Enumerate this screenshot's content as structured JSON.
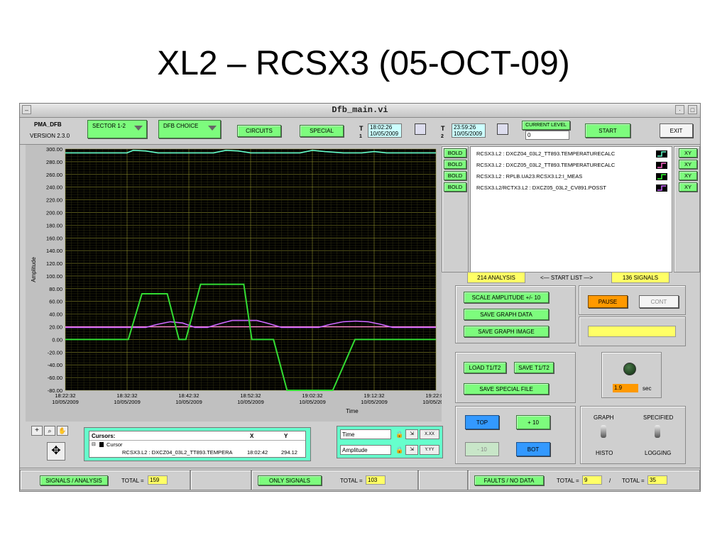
{
  "slide": {
    "title": "XL2 – RCSX3 (05-OCT-09)"
  },
  "window": {
    "title": "Dfb_main.vi",
    "min_glyph": "–",
    "max_glyph": "□"
  },
  "header": {
    "app_name": "PMA_DFB",
    "version": "VERSION 2.3.0",
    "sector_dropdown": "SECTOR 1-2",
    "dfb_dropdown": "DFB CHOICE",
    "circuits_button": "CIRCUITS",
    "special_button": "SPECIAL",
    "t1_label": "T",
    "t1_index": "1",
    "t1_time": "18:02:26",
    "t1_date": "10/05/2009",
    "t2_label": "T",
    "t2_index": "2",
    "t2_time": "23:59:26",
    "t2_date": "10/05/2009",
    "current_level_label": "CURRENT LEVEL",
    "current_level_value": "0",
    "start_button": "START",
    "exit_button": "EXIT"
  },
  "signals": [
    {
      "bold": "BOLD",
      "name": "RCSX3.L2 : DXCZ04_03L2_TT893.TEMPERATURECALC",
      "color": "#66ffcc",
      "xy": "XY"
    },
    {
      "bold": "BOLD",
      "name": "RCSX3.L2 : DXCZ05_03L2_TT893.TEMPERATURECALC",
      "color": "#ff66cc",
      "xy": "XY"
    },
    {
      "bold": "BOLD",
      "name": "RCSX3.L2 : RPLB.UA23.RCSX3.L2:I_MEAS",
      "color": "#33ff33",
      "xy": "XY"
    },
    {
      "bold": "BOLD",
      "name": "RCSX3.L2/RCTX3.L2 : DXCZ05_03L2_CV891.POSST",
      "color": "#cc66ff",
      "xy": "XY"
    }
  ],
  "start_list": {
    "analysis": "214 ANALYSIS",
    "label": "<— START LIST —>",
    "signals": "136 SIGNALS"
  },
  "controls": {
    "scale_amplitude": "SCALE AMPLITUDE +/- 10",
    "save_graph_data": "SAVE GRAPH DATA",
    "save_graph_image": "SAVE GRAPH IMAGE",
    "pause": "PAUSE",
    "cont": "CONT",
    "load_t1t2": "LOAD T1/T2",
    "save_t1t2": "SAVE T1/T2",
    "save_special_file": "SAVE SPECIAL FILE",
    "refresh_value": "1.9",
    "refresh_unit": "sec",
    "top": "TOP",
    "plus10": "+ 10",
    "minus10": "- 10",
    "bot": "BOT",
    "graph_label": "GRAPH",
    "histo_label": "HISTO",
    "specified_label": "SPECIFIED",
    "logging_label": "LOGGING"
  },
  "cursor_panel": {
    "header_cursors": "Cursors:",
    "header_x": "X",
    "header_y": "Y",
    "tree_root": "Cursor",
    "tree_item": "RCSX3.L2 : DXCZ04_03L2_TT893.TEMPERA",
    "x_value": "18:02:42",
    "y_value": "294.12"
  },
  "axis_controls": {
    "time": "Time",
    "amplitude": "Amplitude",
    "time_fmt": "X.XX",
    "amp_fmt": "Y.YY"
  },
  "footer": {
    "signals_analysis": "SIGNALS / ANALYSIS",
    "total1_label": "TOTAL =",
    "total1_value": "159",
    "only_signals": "ONLY SIGNALS",
    "total2_label": "TOTAL =",
    "total2_value": "103",
    "faults": "FAULTS / NO DATA",
    "total3_label": "TOTAL =",
    "total3_value": "9",
    "slash": "/",
    "total4_label": "TOTAL =",
    "total4_value": "35"
  },
  "chart_data": {
    "type": "line",
    "xlabel": "Time",
    "ylabel": "Amplitude",
    "ylim": [
      -80,
      300
    ],
    "yticks": [
      "300.00",
      "280.00",
      "260.00",
      "240.00",
      "220.00",
      "200.00",
      "180.00",
      "160.00",
      "140.00",
      "120.00",
      "100.00",
      "80.00",
      "60.00",
      "40.00",
      "20.00",
      "0.00",
      "-20.00",
      "-40.00",
      "-60.00",
      "-80.00"
    ],
    "xticks": [
      {
        "time": "18:22:32",
        "date": "10/05/2009"
      },
      {
        "time": "18:32:32",
        "date": "10/05/2009"
      },
      {
        "time": "18:42:32",
        "date": "10/05/2009"
      },
      {
        "time": "18:52:32",
        "date": "10/05/2009"
      },
      {
        "time": "19:02:32",
        "date": "10/05/2009"
      },
      {
        "time": "19:12:32",
        "date": "10/05/2009"
      },
      {
        "time": "19:22:03",
        "date": "10/05/2009"
      }
    ],
    "x_minutes_span": [
      0,
      60
    ],
    "grid": true,
    "plot_bg": "#000000",
    "series": [
      {
        "color": "#66ffcc",
        "x": [
          0,
          5,
          10,
          11,
          13,
          15,
          17,
          20,
          24,
          26,
          28,
          30,
          34,
          38,
          40,
          42,
          45,
          48,
          50,
          52,
          55,
          58,
          60
        ],
        "values": [
          294,
          294,
          294,
          298,
          297,
          294,
          294,
          294,
          294,
          298,
          297,
          294,
          294,
          294,
          298,
          296,
          294,
          294,
          296,
          294,
          294,
          294,
          294
        ]
      },
      {
        "color": "#ff88cc",
        "x": [
          0,
          10,
          12,
          14,
          16,
          18,
          20,
          22,
          24,
          26,
          28,
          30,
          33,
          36,
          40,
          42,
          44,
          46,
          48,
          50,
          52,
          54,
          56,
          58,
          60
        ],
        "values": [
          20,
          20,
          20,
          20,
          20,
          20,
          20,
          20,
          20,
          20,
          20,
          20,
          20,
          20,
          20,
          20,
          20,
          20,
          20,
          20,
          20,
          20,
          20,
          20,
          20
        ]
      },
      {
        "color": "#cc66ff",
        "x": [
          0,
          10,
          13,
          15,
          17,
          19,
          21,
          23,
          25,
          27,
          29,
          31,
          33,
          35,
          37,
          39,
          41,
          43,
          45,
          47,
          49,
          51,
          53,
          60
        ],
        "values": [
          19,
          19,
          19,
          24,
          28,
          26,
          19,
          19,
          25,
          30,
          30,
          30,
          25,
          19,
          19,
          19,
          19,
          24,
          28,
          29,
          28,
          24,
          19,
          19
        ]
      },
      {
        "color": "#33dd33",
        "x": [
          0,
          10.2,
          12.4,
          16.5,
          18.4,
          19.5,
          21.9,
          28.9,
          30.2,
          33.7,
          35.9,
          41.4,
          43.3,
          46.9,
          60
        ],
        "values": [
          0,
          0,
          72,
          72,
          0,
          0,
          87,
          87,
          0,
          0,
          -80,
          -80,
          -80,
          0,
          0
        ]
      }
    ]
  }
}
